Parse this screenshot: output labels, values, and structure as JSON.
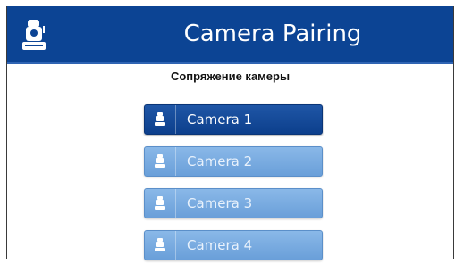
{
  "header": {
    "title": "Camera Pairing",
    "icon": "camera-icon"
  },
  "subtitle": "Сопряжение камеры",
  "cameras": [
    {
      "label": "Camera 1",
      "state": "selected"
    },
    {
      "label": "Camera 2",
      "state": "unselected"
    },
    {
      "label": "Camera 3",
      "state": "unselected"
    },
    {
      "label": "Camera 4",
      "state": "unselected"
    }
  ],
  "colors": {
    "header_bg": "#0c4494",
    "active_button": "#1f56a6",
    "inactive_button": "#7aaee3"
  }
}
